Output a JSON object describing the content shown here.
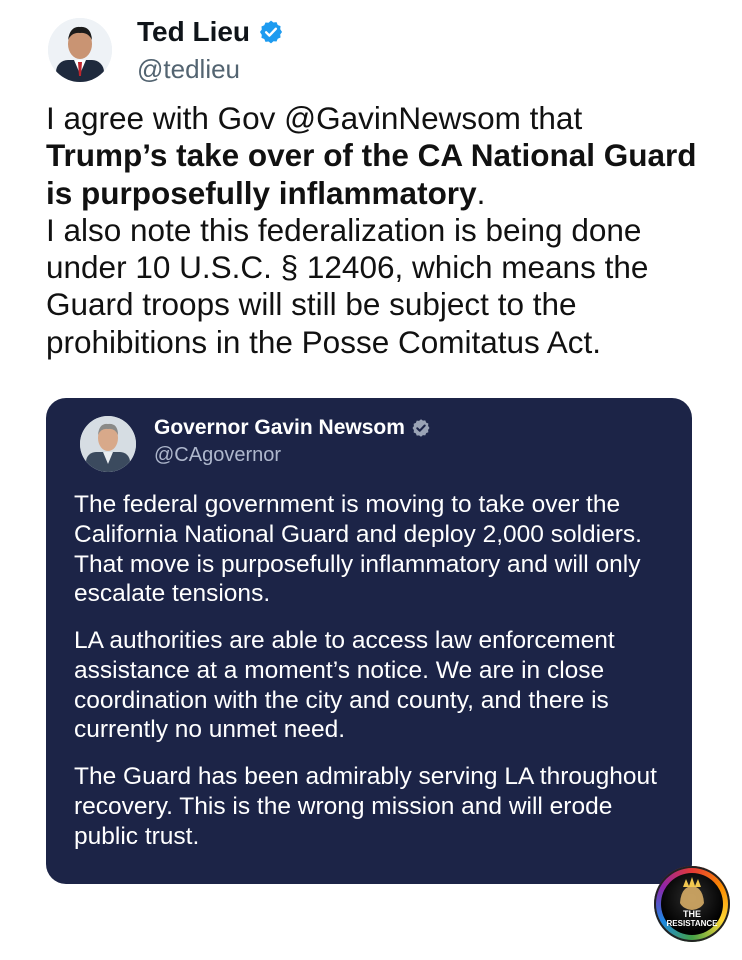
{
  "tweet": {
    "author_name": "Ted Lieu",
    "handle": "@tedlieu",
    "text_intro": "I agree with Gov @GavinNewsom that",
    "text_bold": "Trump’s take over of the CA National Guard is purposefully inflammatory",
    "text_bold_end": ".",
    "text_rest": "I also note this federalization is being done under 10 U.S.C. § 12406, which means the Guard troops will still be subject to the prohibitions in the Posse Comitatus Act."
  },
  "quoted_tweet": {
    "author_name": "Governor Gavin Newsom",
    "handle": "@CAgovernor",
    "paragraphs": [
      "The federal government is moving to take over the California National Guard and deploy 2,000 soldiers. That move is purposefully inflammatory and will only escalate tensions.",
      "LA authorities are able to access law enforcement assistance at a moment’s notice. We are in close coordination with the city and county, and there is currently no unmet need.",
      "The Guard has been admirably serving LA throughout recovery. This is the wrong mission and will erode public trust."
    ]
  },
  "watermark": {
    "line1": "THE",
    "line2": "RESISTANCE"
  },
  "icons": {
    "verified": "verified-badge-icon",
    "watermark": "the-resistance-logo-icon"
  },
  "colors": {
    "verified_blue": "#1d9bf0",
    "quote_background": "#1c2447",
    "handle_gray": "#536471"
  }
}
